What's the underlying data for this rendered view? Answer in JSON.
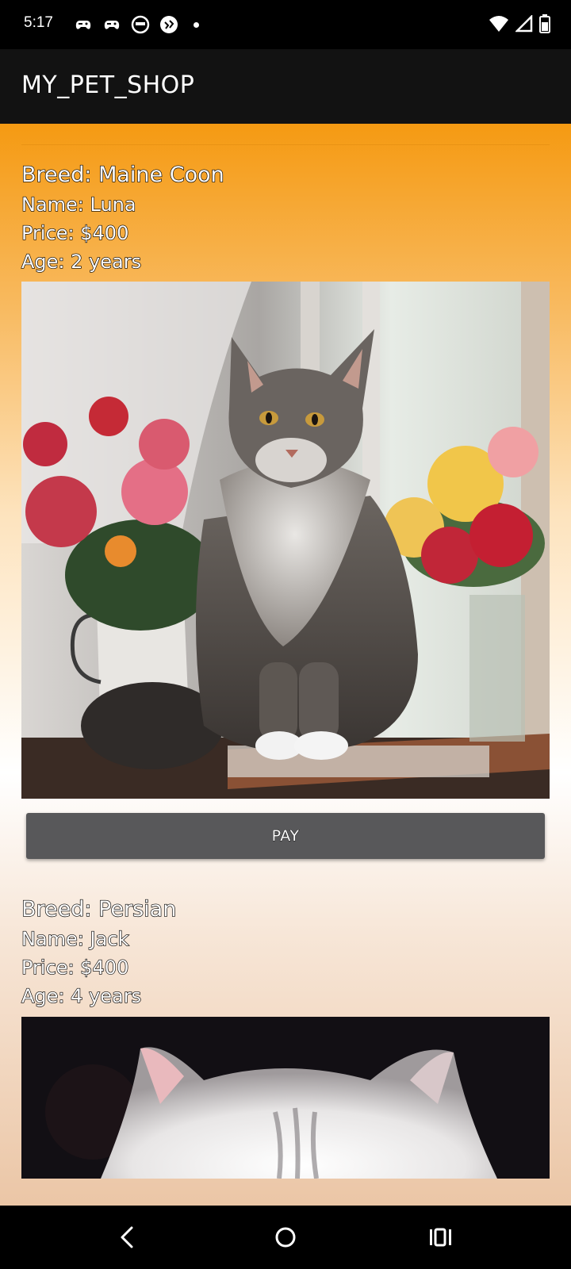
{
  "status_bar": {
    "time": "5:17",
    "notification_icons": [
      "game-controller-icon",
      "game-controller-icon",
      "face-icon",
      "gesture-app-icon",
      "dot-icon"
    ],
    "system_icons": [
      "wifi-icon",
      "cell-signal-icon",
      "battery-icon"
    ]
  },
  "app_bar": {
    "title": "MY_PET_SHOP"
  },
  "pets": [
    {
      "breed": "Breed: Maine Coon",
      "name": "Name: Luna",
      "price": "Price: $400",
      "age": "Age: 2 years",
      "button_label": "PAY"
    },
    {
      "breed": "Breed: Persian",
      "name": "Name: Jack",
      "price": "Price: $400",
      "age": "Age: 4 years"
    }
  ],
  "nav_bar": {
    "buttons": [
      "back-icon",
      "home-icon",
      "recents-icon"
    ]
  }
}
